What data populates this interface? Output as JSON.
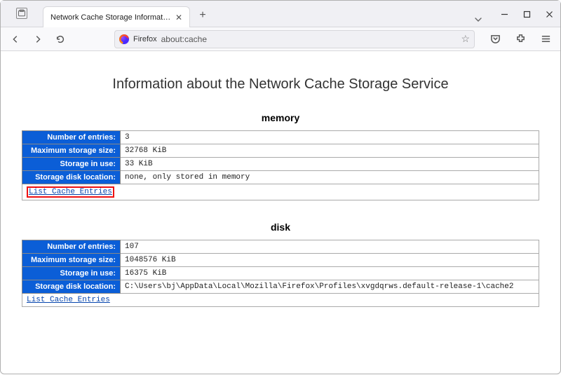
{
  "browser": {
    "tab_title": "Network Cache Storage Information",
    "identity_label": "Firefox",
    "url": "about:cache"
  },
  "page": {
    "title": "Information about the Network Cache Storage Service"
  },
  "labels": {
    "num_entries": "Number of entries:",
    "max_size": "Maximum storage size:",
    "in_use": "Storage in use:",
    "disk_location": "Storage disk location:",
    "list_entries": "List Cache Entries"
  },
  "sections": [
    {
      "heading": "memory",
      "num_entries": "3",
      "max_size": "32768 KiB",
      "in_use": "33 KiB",
      "disk_location": "none, only stored in memory",
      "highlight_link": true
    },
    {
      "heading": "disk",
      "num_entries": "107",
      "max_size": "1048576 KiB",
      "in_use": "16375 KiB",
      "disk_location": "C:\\Users\\bj\\AppData\\Local\\Mozilla\\Firefox\\Profiles\\xvgdqrws.default-release-1\\cache2",
      "highlight_link": false
    }
  ]
}
